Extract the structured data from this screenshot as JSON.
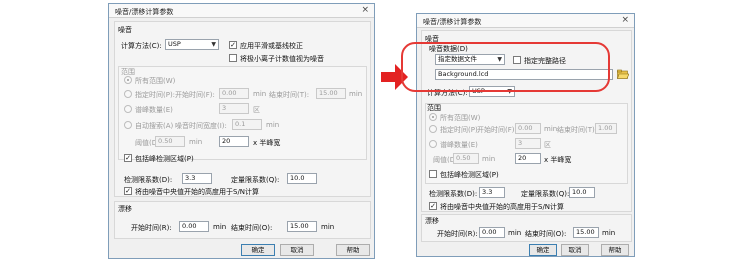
{
  "left": {
    "title": "噪音/漂移计算参数",
    "close": "×",
    "noise": {
      "header": "噪音",
      "method_label": "计算方法(C):",
      "method_value": "USP",
      "apply_baseline": "应用平滑或基线校正",
      "small_peak_noise": "将极小离子计数值视为噪音"
    },
    "range": {
      "header": "范围",
      "all_range": "所有范围(W)",
      "specified_time": "指定时间(P):",
      "start_time_label": "开始时间(F):",
      "start_time_value": "0.00",
      "end_time_label": "结束时间(T):",
      "end_time_value": "15.00",
      "min": "min",
      "peak_count_label": "谱峰数量(E)",
      "peak_count_value": "3",
      "peak_count_unit": "区",
      "auto_search": "自动搜索(A)",
      "noise_time_width_label": "噪音时间宽度(I):",
      "noise_time_width_value": "0.1",
      "threshold_label": "阈值(D):",
      "threshold_value": "0.50",
      "half_width_value": "20",
      "half_width_suffix": "x 半峰宽",
      "include_peak_region": "包括峰检测区域(P)"
    },
    "detect_limit_label": "检测限系数(D):",
    "detect_limit_value": "3.3",
    "quant_limit_label": "定量限系数(Q):",
    "quant_limit_value": "10.0",
    "center_height": "将由噪音中央值开始的高度用于S/N计算",
    "drift": {
      "header": "漂移",
      "start_label": "开始时间(R):",
      "start_value": "0.00",
      "end_label": "结束时间(O):",
      "end_value": "15.00",
      "min": "min"
    },
    "buttons": {
      "ok": "确定",
      "cancel": "取消",
      "help": "帮助"
    }
  },
  "right": {
    "title": "噪音/漂移计算参数",
    "close": "×",
    "noise": {
      "header": "噪音",
      "data_label": "噪音数据(D)",
      "data_source_value": "指定数据文件",
      "specify_full_path": "指定完整路径",
      "file_value": "Background.lcd",
      "method_label": "计算方法(C):",
      "method_value": "USP"
    },
    "range": {
      "header": "范围",
      "all_range": "所有范围(W)",
      "specified_time": "指定时间(P):",
      "start_time_label": "开始时间(F):",
      "start_time_value": "0.00",
      "end_time_label": "结束时间(T):",
      "end_time_value": "1.00",
      "min": "min",
      "peak_count_label": "谱峰数量(E)",
      "peak_count_value": "3",
      "peak_count_unit": "区",
      "threshold_label": "阈值(D):",
      "threshold_value": "0.50",
      "half_width_value": "20",
      "half_width_suffix": "x 半峰宽",
      "include_peak_region": "包括峰检测区域(P)"
    },
    "detect_limit_label": "检测限系数(D):",
    "detect_limit_value": "3.3",
    "quant_limit_label": "定量限系数(Q):",
    "quant_limit_value": "10.0",
    "center_height": "将由噪音中央值开始的高度用于S/N计算",
    "drift": {
      "header": "漂移",
      "start_label": "开始时间(R):",
      "start_value": "0.00",
      "end_label": "结束时间(O):",
      "end_value": "15.00",
      "min": "min"
    },
    "buttons": {
      "ok": "确定",
      "cancel": "取消",
      "help": "帮助"
    }
  },
  "colors": {
    "highlight": "#e53935",
    "arrow": "#e32222",
    "dialog_bg": "#f0f0f0"
  }
}
